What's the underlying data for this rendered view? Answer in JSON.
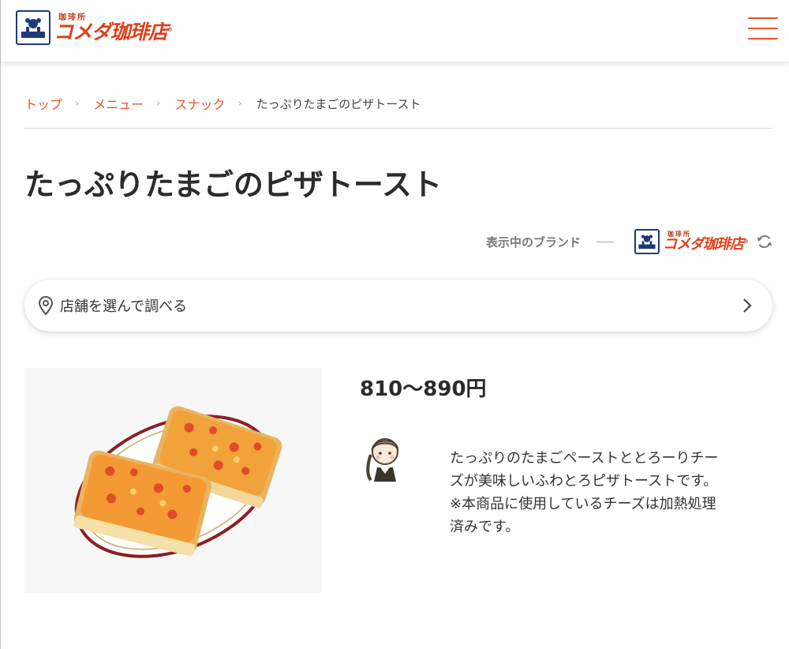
{
  "header": {
    "logo_sub": "珈琲所",
    "logo_main": "コメダ珈琲店",
    "logo_registered": "®",
    "menu_icon": "hamburger-menu-icon"
  },
  "breadcrumb": [
    {
      "label": "トップ"
    },
    {
      "label": "メニュー"
    },
    {
      "label": "スナック"
    },
    {
      "label": "たっぷりたまごのピザトースト"
    }
  ],
  "page": {
    "title": "たっぷりたまごのピザトースト"
  },
  "brand": {
    "label": "表示中のブランド",
    "logo_sub": "珈琲所",
    "logo_main": "コメダ珈琲店",
    "logo_registered": "®",
    "refresh_icon": "refresh-icon"
  },
  "store_search": {
    "label": "店舗を選んで調べる",
    "icon": "map-pin-icon"
  },
  "product": {
    "price": "810〜890円",
    "description": "たっぷりのたまごペーストととろーりチーズが美味しいふわとろピザトーストです。※本商品に使用しているチーズは加熱処理済みです。",
    "description_lines": [
      "たっぷりのたまごペーストととろーりチー",
      "ズが美味しいふわとろピザトーストです。",
      "※本商品に使用しているチーズは加熱処理",
      "済みです。"
    ]
  },
  "colors": {
    "accent": "#e8542b",
    "brand_red": "#dd3e1a",
    "brand_navy": "#1f3a78",
    "text": "#2b2b2b"
  }
}
